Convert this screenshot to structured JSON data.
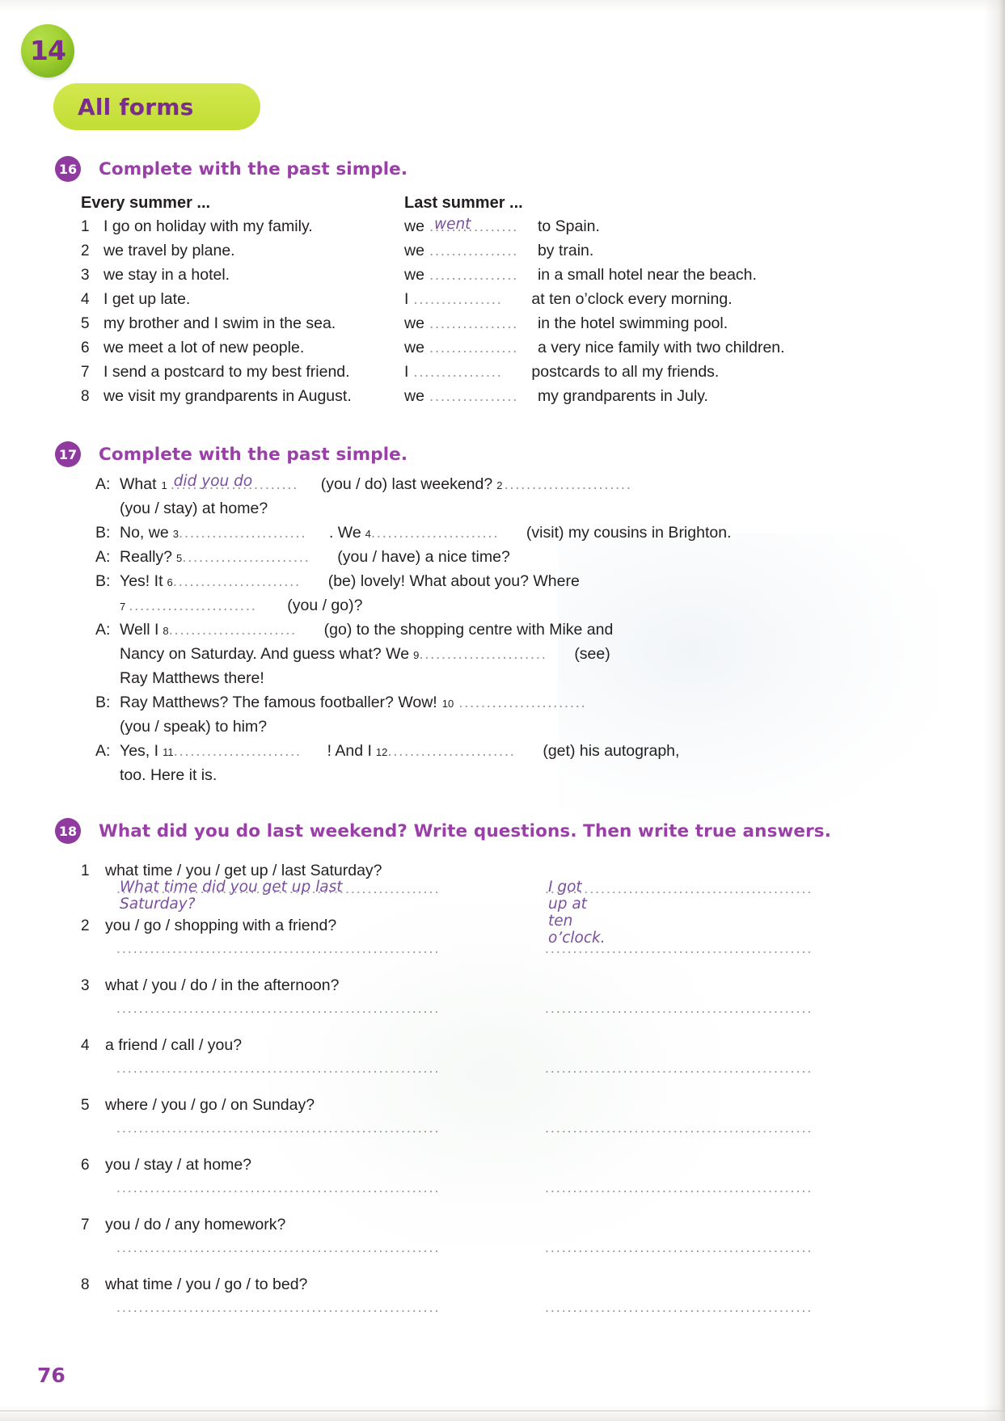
{
  "unit": {
    "number": "14"
  },
  "section": {
    "title": "All forms"
  },
  "exercise16": {
    "number": "16",
    "title": "Complete with the past simple.",
    "left_heading": "Every summer ...",
    "right_heading": "Last summer ...",
    "items": [
      {
        "n": "1",
        "prompt": "I go on holiday with my family.",
        "subject": "we",
        "answer": "went",
        "rest": "to Spain."
      },
      {
        "n": "2",
        "prompt": "we travel by plane.",
        "subject": "we",
        "answer": "",
        "rest": "by train."
      },
      {
        "n": "3",
        "prompt": "we stay in a hotel.",
        "subject": "we",
        "answer": "",
        "rest": "in a small hotel near the beach."
      },
      {
        "n": "4",
        "prompt": "I get up late.",
        "subject": "I",
        "answer": "",
        "rest": "at ten o’clock every morning."
      },
      {
        "n": "5",
        "prompt": "my brother and I swim in the sea.",
        "subject": "we",
        "answer": "",
        "rest": "in the hotel swimming pool."
      },
      {
        "n": "6",
        "prompt": "we meet a lot of new people.",
        "subject": "we",
        "answer": "",
        "rest": "a very nice family with two children."
      },
      {
        "n": "7",
        "prompt": "I send a postcard to my best friend.",
        "subject": "I",
        "answer": "",
        "rest": "postcards to all my friends."
      },
      {
        "n": "8",
        "prompt": "we visit my grandparents in August.",
        "subject": "we",
        "answer": "",
        "rest": "my grandparents in July."
      }
    ]
  },
  "exercise17": {
    "number": "17",
    "title": "Complete with the past simple.",
    "lines": [
      {
        "speaker": "A:",
        "pre": "What",
        "sup1": "1",
        "hand": "did you do",
        "mid": "(you / do) last weekend?",
        "sup2": "2",
        "post": ""
      },
      {
        "speaker": "",
        "pre": "(you / stay) at home?"
      },
      {
        "speaker": "B:",
        "pre": "No, we",
        "sup1": "3",
        "mid": ". We",
        "sup2": "4",
        "post": "(visit) my cousins in Brighton."
      },
      {
        "speaker": "A:",
        "pre": "Really?",
        "sup1": "5",
        "mid": "(you / have) a nice time?"
      },
      {
        "speaker": "B:",
        "pre": "Yes! It",
        "sup1": "6",
        "mid": "(be) lovely! What about you? Where"
      },
      {
        "speaker": "",
        "sup1": "7",
        "mid": "(you / go)?"
      },
      {
        "speaker": "A:",
        "pre": "Well I",
        "sup1": "8",
        "mid": "(go) to the shopping centre with Mike and"
      },
      {
        "speaker": "",
        "pre": "Nancy on Saturday. And guess what? We",
        "sup1": "9",
        "mid": "(see)"
      },
      {
        "speaker": "",
        "pre": "Ray Matthews there!"
      },
      {
        "speaker": "B:",
        "pre": "Ray Matthews? The famous footballer? Wow!",
        "sup1": "10"
      },
      {
        "speaker": "",
        "pre": "(you / speak) to him?"
      },
      {
        "speaker": "A:",
        "pre": "Yes, I",
        "sup1": "11",
        "mid": "! And I",
        "sup2": "12",
        "post": "(get) his autograph,"
      },
      {
        "speaker": "",
        "pre": "too. Here it is."
      }
    ]
  },
  "exercise18": {
    "number": "18",
    "title": "What did you do last weekend? Write questions. Then write true answers.",
    "items": [
      {
        "n": "1",
        "prompt": "what time / you / get up / last Saturday?",
        "question": "What time did you get up last Saturday?",
        "answer": "I got up at ten o’clock."
      },
      {
        "n": "2",
        "prompt": "you / go / shopping with a friend?",
        "question": "",
        "answer": ""
      },
      {
        "n": "3",
        "prompt": "what / you / do / in the afternoon?",
        "question": "",
        "answer": ""
      },
      {
        "n": "4",
        "prompt": "a friend / call / you?",
        "question": "",
        "answer": ""
      },
      {
        "n": "5",
        "prompt": "where / you / go / on Sunday?",
        "question": "",
        "answer": ""
      },
      {
        "n": "6",
        "prompt": "you / stay / at home?",
        "question": "",
        "answer": ""
      },
      {
        "n": "7",
        "prompt": "you / do / any homework?",
        "question": "",
        "answer": ""
      },
      {
        "n": "8",
        "prompt": "what time / you / go / to bed?",
        "question": "",
        "answer": ""
      }
    ]
  },
  "footer": {
    "page_number": "76"
  },
  "colors": {
    "purple": "#8e3a9e",
    "heading_purple": "#9b3fa8",
    "handwriting_purple": "#7b4fa0",
    "lime": "#c9e243",
    "badge_green": "#a2d134",
    "text": "#231f20",
    "dots_gray": "#9a9a9a"
  }
}
